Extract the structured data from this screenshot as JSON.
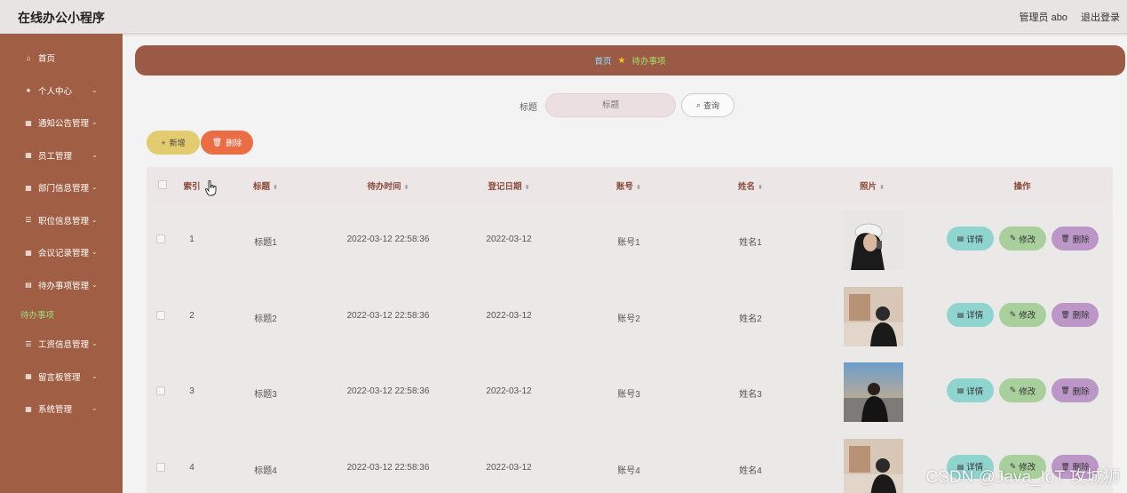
{
  "app": {
    "title": "在线办公小程序"
  },
  "header": {
    "user": "管理员 abo",
    "logout": "退出登录"
  },
  "sidebar": {
    "items": [
      {
        "label": "首页",
        "icon": "home-icon",
        "glyph": "⌂",
        "expandable": false
      },
      {
        "label": "个人中心",
        "icon": "user-icon",
        "glyph": "●",
        "expandable": true
      },
      {
        "label": "通知公告管理",
        "icon": "notice-icon",
        "glyph": "▦",
        "expandable": true
      },
      {
        "label": "员工管理",
        "icon": "grid-icon",
        "glyph": "▦",
        "expandable": true
      },
      {
        "label": "部门信息管理",
        "icon": "grid-icon",
        "glyph": "▦",
        "expandable": true
      },
      {
        "label": "职位信息管理",
        "icon": "sliders-icon",
        "glyph": "☰",
        "expandable": true
      },
      {
        "label": "会议记录管理",
        "icon": "grid-icon",
        "glyph": "▦",
        "expandable": true
      },
      {
        "label": "待办事项管理",
        "icon": "todo-icon",
        "glyph": "▤",
        "expandable": true
      },
      {
        "label": "待办事项",
        "icon": "",
        "glyph": "",
        "expandable": false,
        "sub": true
      },
      {
        "label": "工资信息管理",
        "icon": "list-icon",
        "glyph": "☰",
        "expandable": true
      },
      {
        "label": "留言板管理",
        "icon": "grid-icon",
        "glyph": "▦",
        "expandable": true
      },
      {
        "label": "系统管理",
        "icon": "grid-icon",
        "glyph": "▦",
        "expandable": true
      }
    ]
  },
  "breadcrumb": {
    "home": "首页",
    "current": "待办事项"
  },
  "search": {
    "label": "标题",
    "placeholder": "标题",
    "button": "查询"
  },
  "toolbar": {
    "add": "新增",
    "delete": "删除"
  },
  "table": {
    "columns": [
      "索引",
      "标题",
      "待办时间",
      "登记日期",
      "账号",
      "姓名",
      "照片",
      "操作"
    ],
    "rows": [
      {
        "index": "1",
        "title": "标题1",
        "todo_time": "2022-03-12 22:58:36",
        "date": "2022-03-12",
        "account": "账号1",
        "name": "姓名1"
      },
      {
        "index": "2",
        "title": "标题2",
        "todo_time": "2022-03-12 22:58:36",
        "date": "2022-03-12",
        "account": "账号2",
        "name": "姓名2"
      },
      {
        "index": "3",
        "title": "标题3",
        "todo_time": "2022-03-12 22:58:36",
        "date": "2022-03-12",
        "account": "账号3",
        "name": "姓名3"
      },
      {
        "index": "4",
        "title": "标题4",
        "todo_time": "2022-03-12 22:58:36",
        "date": "2022-03-12",
        "account": "账号4",
        "name": "姓名4"
      }
    ],
    "actions": {
      "detail": "详情",
      "edit": "修改",
      "delete": "删除"
    }
  },
  "watermark": "CSDN @Java_IoT 攻城狮"
}
